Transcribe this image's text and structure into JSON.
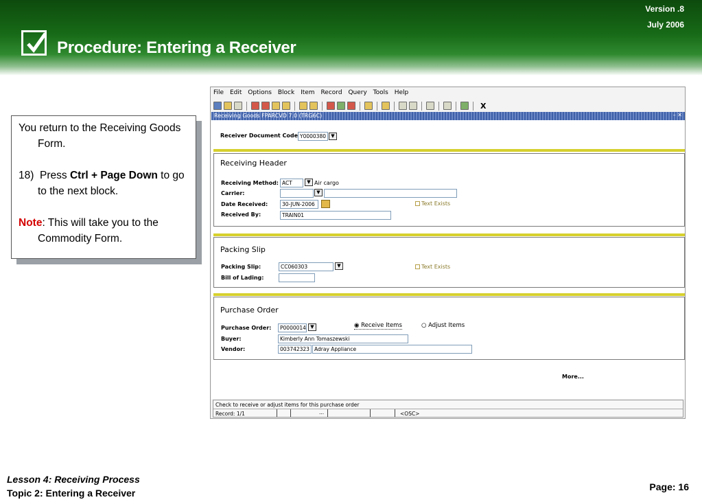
{
  "slide": {
    "title": "Procedure: Entering a Receiver",
    "version": "Version .8",
    "date": "July  2006"
  },
  "callout": {
    "intro": "You return to the Receiving Goods Form.",
    "step_num": "18)",
    "step_pre": "Press ",
    "step_keys": "Ctrl + Page Down",
    "step_post": " to go to the next block.",
    "note_label": "Note",
    "note_text": ":  This will take you to the Commodity Form."
  },
  "app": {
    "menu": [
      "File",
      "Edit",
      "Options",
      "Block",
      "Item",
      "Record",
      "Query",
      "Tools",
      "Help"
    ],
    "toolbar_exit": "X",
    "form_title": "Receiving Goods  FPARCVD  7.0  (TRG6C)",
    "window_controls": "– ✕",
    "receiver_doc_label": "Receiver Document Code",
    "receiver_doc_value": "Y0000380",
    "header": {
      "title": "Receiving Header",
      "method_label": "Receiving Method:",
      "method_value": "ACT",
      "method_desc": "Air cargo",
      "carrier_label": "Carrier:",
      "carrier_value": "",
      "carrier_desc": "",
      "date_label": "Date Received:",
      "date_value": "30-JUN-2006",
      "received_by_label": "Received By:",
      "received_by_value": "TRAIN01",
      "text_exists": "Text Exists"
    },
    "packing": {
      "title": "Packing Slip",
      "slip_label": "Packing Slip:",
      "slip_value": "CC060303",
      "lading_label": "Bill of Lading:",
      "lading_value": "",
      "text_exists": "Text Exists"
    },
    "po": {
      "title": "Purchase Order",
      "po_label": "Purchase Order:",
      "po_value": "P0000014",
      "receive_items": "Receive Items",
      "adjust_items": "Adjust Items",
      "buyer_label": "Buyer:",
      "buyer_value": "Kimberly Ann  Tomaszewski",
      "vendor_label": "Vendor:",
      "vendor_id": "003742323",
      "vendor_name": "Adray Appliance"
    },
    "more": "More...",
    "status_message": "Check to receive or adjust items for this purchase order",
    "record": "Record: 1/1",
    "status_dots": "...",
    "osc": "<OSC>"
  },
  "footer": {
    "lesson": "Lesson 4: Receiving Process",
    "topic": "Topic 2: Entering a Receiver",
    "page": "Page: 16"
  }
}
